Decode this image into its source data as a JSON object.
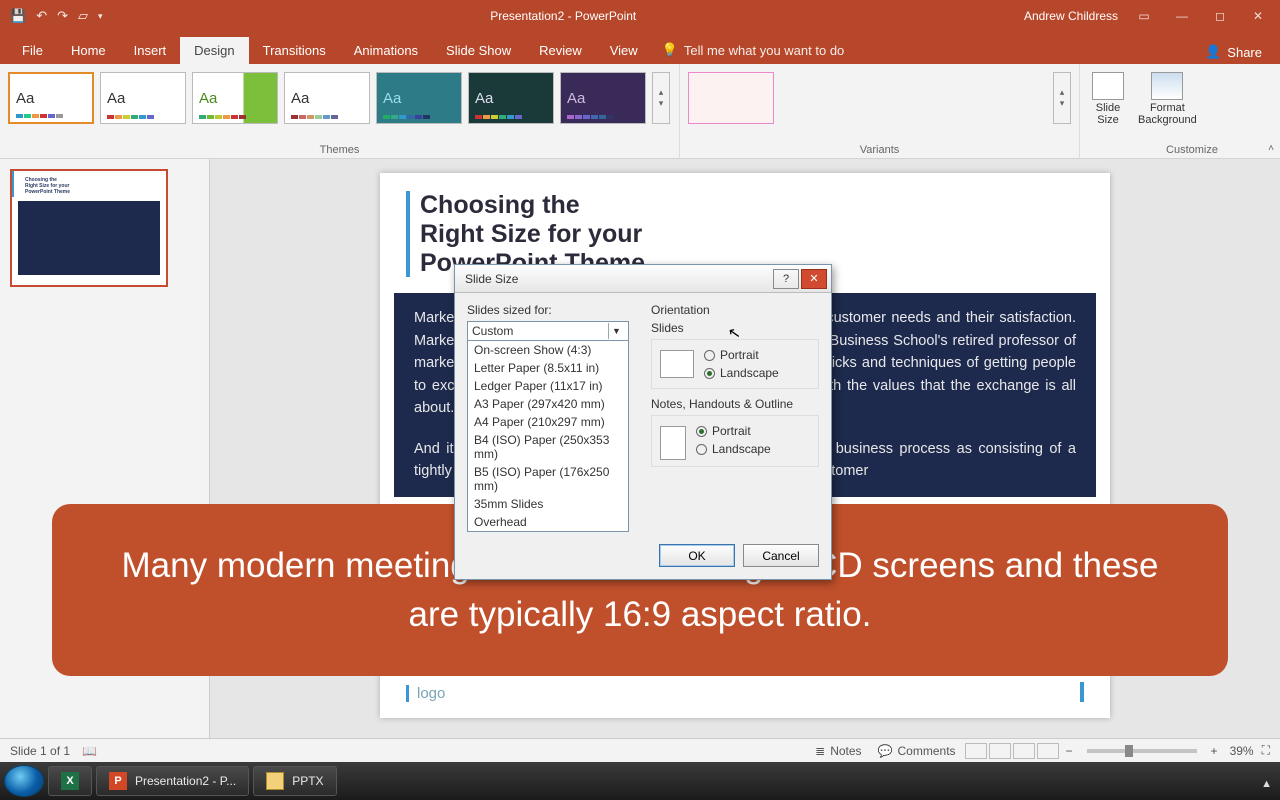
{
  "title_bar": {
    "doc_title": "Presentation2 - PowerPoint",
    "user_name": "Andrew Childress"
  },
  "ribbon": {
    "file": "File",
    "tabs": [
      "Home",
      "Insert",
      "Design",
      "Transitions",
      "Animations",
      "Slide Show",
      "Review",
      "View"
    ],
    "active_tab": "Design",
    "tellme": "Tell me what you want to do",
    "share": "Share",
    "group_themes": "Themes",
    "group_variants": "Variants",
    "group_customize": "Customize",
    "slide_size": "Slide\nSize",
    "format_bg": "Format\nBackground"
  },
  "slide": {
    "index": "1",
    "title": "Choosing the\nRight Size for your\nPowerPoint Theme",
    "body_p1": "Marketing is based on thinking about the business in terms of customer needs and their satisfaction. Marketing differs from selling because (in the words of Harvard Business School's retired professor of marketing Theodore C. Levitt) \"Selling concerns itself with the tricks and techniques of getting people to exchange their cash for your product. It is not concerned with the values that the exchange is all about.",
    "body_p2": "And it does not, as marketing invariable does, view the entire business process as consisting of a tightly integrated effort to discover, create, arouse and satisfy customer",
    "logo": "logo"
  },
  "dialog": {
    "title": "Slide Size",
    "label_sized": "Slides sized for:",
    "combo_value": "Custom",
    "options": [
      "On-screen Show (4:3)",
      "Letter Paper (8.5x11 in)",
      "Ledger Paper (11x17 in)",
      "A3 Paper (297x420 mm)",
      "A4 Paper (210x297 mm)",
      "B4 (ISO) Paper (250x353 mm)",
      "B5 (ISO) Paper (176x250 mm)",
      "35mm Slides",
      "Overhead"
    ],
    "orientation": "Orientation",
    "slides": "Slides",
    "notes": "Notes, Handouts & Outline",
    "portrait": "Portrait",
    "landscape": "Landscape",
    "ok": "OK",
    "cancel": "Cancel"
  },
  "banner": "Many modern meeting rooms feature large LCD screens and these are typically 16:9 aspect ratio.",
  "status": {
    "slide_n": "Slide 1 of 1",
    "notes": "Notes",
    "comments": "Comments",
    "zoom": "39%"
  },
  "taskbar": {
    "ppt": "Presentation2 - P...",
    "folder": "PPTX"
  }
}
